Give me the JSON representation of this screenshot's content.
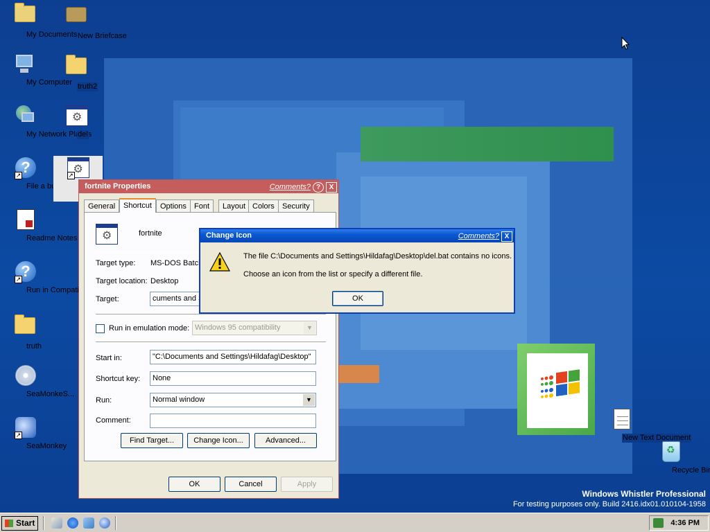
{
  "desktop": {
    "icons": [
      {
        "label": "My Documents"
      },
      {
        "label": "New Briefcase"
      },
      {
        "label": "My Computer"
      },
      {
        "label": "truth2"
      },
      {
        "label": "My Network Places"
      },
      {
        "label": "del"
      },
      {
        "label": "File a bug report"
      },
      {
        "label": "fortnite"
      },
      {
        "label": "Readme Notes"
      },
      {
        "label": "Run in Compatibilit..."
      },
      {
        "label": "truth"
      },
      {
        "label": "SeaMonkeS..."
      },
      {
        "label": "SeaMonkey"
      },
      {
        "label": "New Text Document"
      },
      {
        "label": "Recycle Bin"
      }
    ],
    "branding": {
      "line1": "Windows Whistler Professional",
      "line2": "For testing purposes only. Build 2416.idx01.010104-1958"
    }
  },
  "properties_window": {
    "title": "fortnite Properties",
    "comments_link": "Comments?",
    "help_button": "?",
    "close_button": "X",
    "tabs": [
      "General",
      "Shortcut",
      "Options",
      "Font",
      "Layout",
      "Colors",
      "Security"
    ],
    "active_tab": "Shortcut",
    "name": "fortnite",
    "target_type_label": "Target type:",
    "target_type_value": "MS-DOS Batch",
    "target_location_label": "Target location:",
    "target_location_value": "Desktop",
    "target_label": "Target:",
    "target_value": "cuments and S",
    "emulation_label": "Run in emulation mode:",
    "emulation_value": "Windows 95 compatibility",
    "start_in_label": "Start in:",
    "start_in_value": "\"C:\\Documents and Settings\\Hildafag\\Desktop\"",
    "shortcut_key_label": "Shortcut key:",
    "shortcut_key_value": "None",
    "run_label": "Run:",
    "run_value": "Normal window",
    "comment_label": "Comment:",
    "comment_value": "",
    "find_target": "Find Target...",
    "change_icon": "Change Icon...",
    "advanced": "Advanced...",
    "ok": "OK",
    "cancel": "Cancel",
    "apply": "Apply"
  },
  "change_icon_dialog": {
    "title": "Change Icon",
    "comments_link": "Comments?",
    "close_button": "X",
    "message1": "The file C:\\Documents and Settings\\Hildafag\\Desktop\\del.bat contains no icons.",
    "message2": "Choose an icon from the list or specify a different file.",
    "ok": "OK"
  },
  "taskbar": {
    "start_label": "Start",
    "clock": "4:36 PM"
  },
  "colors": {
    "active_title": "#0a58d0",
    "inactive_title": "#c95a5a",
    "desktop": "#0c4aa3"
  }
}
